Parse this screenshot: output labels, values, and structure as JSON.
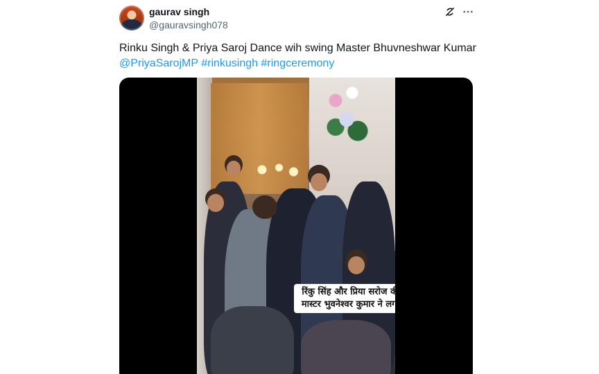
{
  "author": {
    "name": "gaurav singh",
    "handle": "@gauravsingh078"
  },
  "icons": {
    "grok": "grok-icon",
    "more": "more-icon"
  },
  "tweet": {
    "text": "Rinku Singh & Priya Saroj Dance wih swing Master Bhuvneshwar Kumar",
    "mention": "@PriyaSarojMP",
    "hashtags": [
      "#rinkusingh",
      "#ringceremony"
    ]
  },
  "media": {
    "caption": "रिंकु सिंह और प्रिया सरोज की सगाई में स्विंग मास्टर भुवनेश्वर कुमार ने लगाए ठुमके 😍🏏"
  },
  "colors": {
    "link": "#1d9bf0",
    "text": "#0f1419",
    "secondary": "#536471"
  }
}
